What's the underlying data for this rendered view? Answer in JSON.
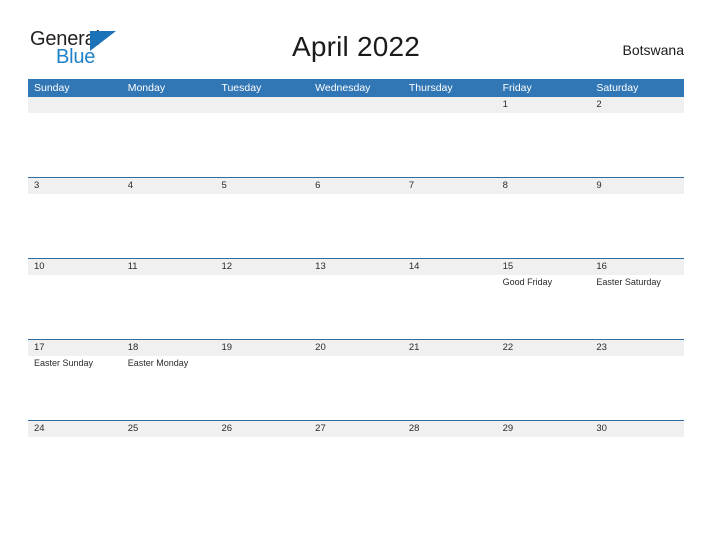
{
  "brand": {
    "word_one": "General",
    "word_two": "Blue",
    "flag_icon": "blue-triangle-flag-icon",
    "color_dark": "#231f20",
    "color_blue": "#2181c8"
  },
  "header": {
    "title": "April 2022",
    "country": "Botswana"
  },
  "theme": {
    "header_blue": "#3176b5",
    "row_rule_blue": "#2e6da4",
    "date_strip_gray": "#f0f0f0",
    "text_dark": "#2b2b2b"
  },
  "calendar": {
    "weekdays": [
      "Sunday",
      "Monday",
      "Tuesday",
      "Wednesday",
      "Thursday",
      "Friday",
      "Saturday"
    ],
    "weeks": [
      {
        "days": [
          {
            "num": "",
            "event": ""
          },
          {
            "num": "",
            "event": ""
          },
          {
            "num": "",
            "event": ""
          },
          {
            "num": "",
            "event": ""
          },
          {
            "num": "",
            "event": ""
          },
          {
            "num": "1",
            "event": ""
          },
          {
            "num": "2",
            "event": ""
          }
        ]
      },
      {
        "days": [
          {
            "num": "3",
            "event": ""
          },
          {
            "num": "4",
            "event": ""
          },
          {
            "num": "5",
            "event": ""
          },
          {
            "num": "6",
            "event": ""
          },
          {
            "num": "7",
            "event": ""
          },
          {
            "num": "8",
            "event": ""
          },
          {
            "num": "9",
            "event": ""
          }
        ]
      },
      {
        "days": [
          {
            "num": "10",
            "event": ""
          },
          {
            "num": "11",
            "event": ""
          },
          {
            "num": "12",
            "event": ""
          },
          {
            "num": "13",
            "event": ""
          },
          {
            "num": "14",
            "event": ""
          },
          {
            "num": "15",
            "event": "Good Friday"
          },
          {
            "num": "16",
            "event": "Easter Saturday"
          }
        ]
      },
      {
        "days": [
          {
            "num": "17",
            "event": "Easter Sunday"
          },
          {
            "num": "18",
            "event": "Easter Monday"
          },
          {
            "num": "19",
            "event": ""
          },
          {
            "num": "20",
            "event": ""
          },
          {
            "num": "21",
            "event": ""
          },
          {
            "num": "22",
            "event": ""
          },
          {
            "num": "23",
            "event": ""
          }
        ]
      },
      {
        "days": [
          {
            "num": "24",
            "event": ""
          },
          {
            "num": "25",
            "event": ""
          },
          {
            "num": "26",
            "event": ""
          },
          {
            "num": "27",
            "event": ""
          },
          {
            "num": "28",
            "event": ""
          },
          {
            "num": "29",
            "event": ""
          },
          {
            "num": "30",
            "event": ""
          }
        ]
      }
    ]
  }
}
